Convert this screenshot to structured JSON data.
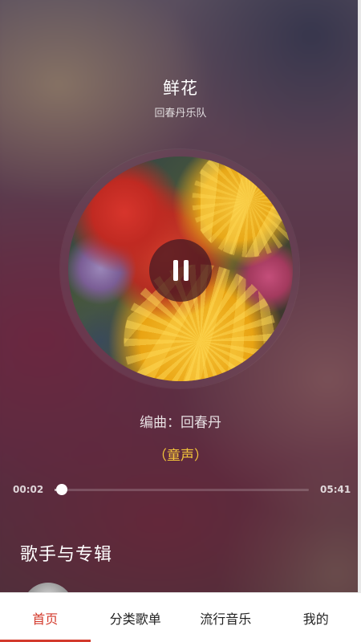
{
  "player": {
    "title": "鲜花",
    "artist": "回春丹乐队",
    "lyrics": {
      "line1": "编曲：回春丹",
      "line2": "（童声）"
    },
    "time_current": "00:02",
    "time_total": "05:41",
    "progress_fraction": 0.006,
    "controls": {
      "pause_icon": "pause-icon"
    }
  },
  "section": {
    "title": "歌手与专辑"
  },
  "bottom_nav": {
    "tabs": [
      {
        "label": "首页",
        "active": true
      },
      {
        "label": "分类歌单",
        "active": false
      },
      {
        "label": "流行音乐",
        "active": false
      },
      {
        "label": "我的",
        "active": false
      }
    ]
  },
  "colors": {
    "accent": "#d33a2c",
    "lyric_highlight": "#f2c43a"
  }
}
